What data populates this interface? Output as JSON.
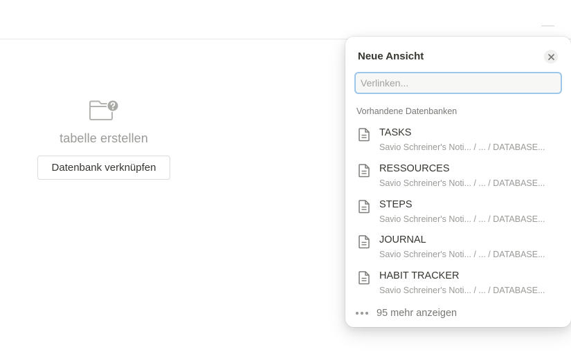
{
  "empty_state": {
    "title": "tabelle erstellen",
    "link_button_label": "Datenbank verknüpfen",
    "icon": "folder-question-icon"
  },
  "popover": {
    "title": "Neue Ansicht",
    "close_icon": "close-icon",
    "search": {
      "value": "",
      "placeholder": "Verlinken..."
    },
    "section_label": "Vorhandene Datenbanken",
    "items": [
      {
        "name": "TASKS",
        "path": "Savio Schreiner's Noti... / ... / DATABASE...",
        "icon": "page-icon"
      },
      {
        "name": "RESSOURCES",
        "path": "Savio Schreiner's Noti... / ... / DATABASE...",
        "icon": "page-icon"
      },
      {
        "name": "STEPS",
        "path": "Savio Schreiner's Noti... / ... / DATABASE...",
        "icon": "page-icon"
      },
      {
        "name": "JOURNAL",
        "path": "Savio Schreiner's Noti... / ... / DATABASE...",
        "icon": "page-icon"
      },
      {
        "name": "HABIT TRACKER",
        "path": "Savio Schreiner's Noti... / ... / DATABASE...",
        "icon": "page-icon"
      }
    ],
    "show_more_label": "95 mehr anzeigen",
    "show_more_icon": "more-dots-icon"
  },
  "colors": {
    "text_primary": "#37352f",
    "text_muted": "#9b9a97",
    "focus_ring": "#9cc6ea",
    "divider": "#e9e9e7"
  }
}
